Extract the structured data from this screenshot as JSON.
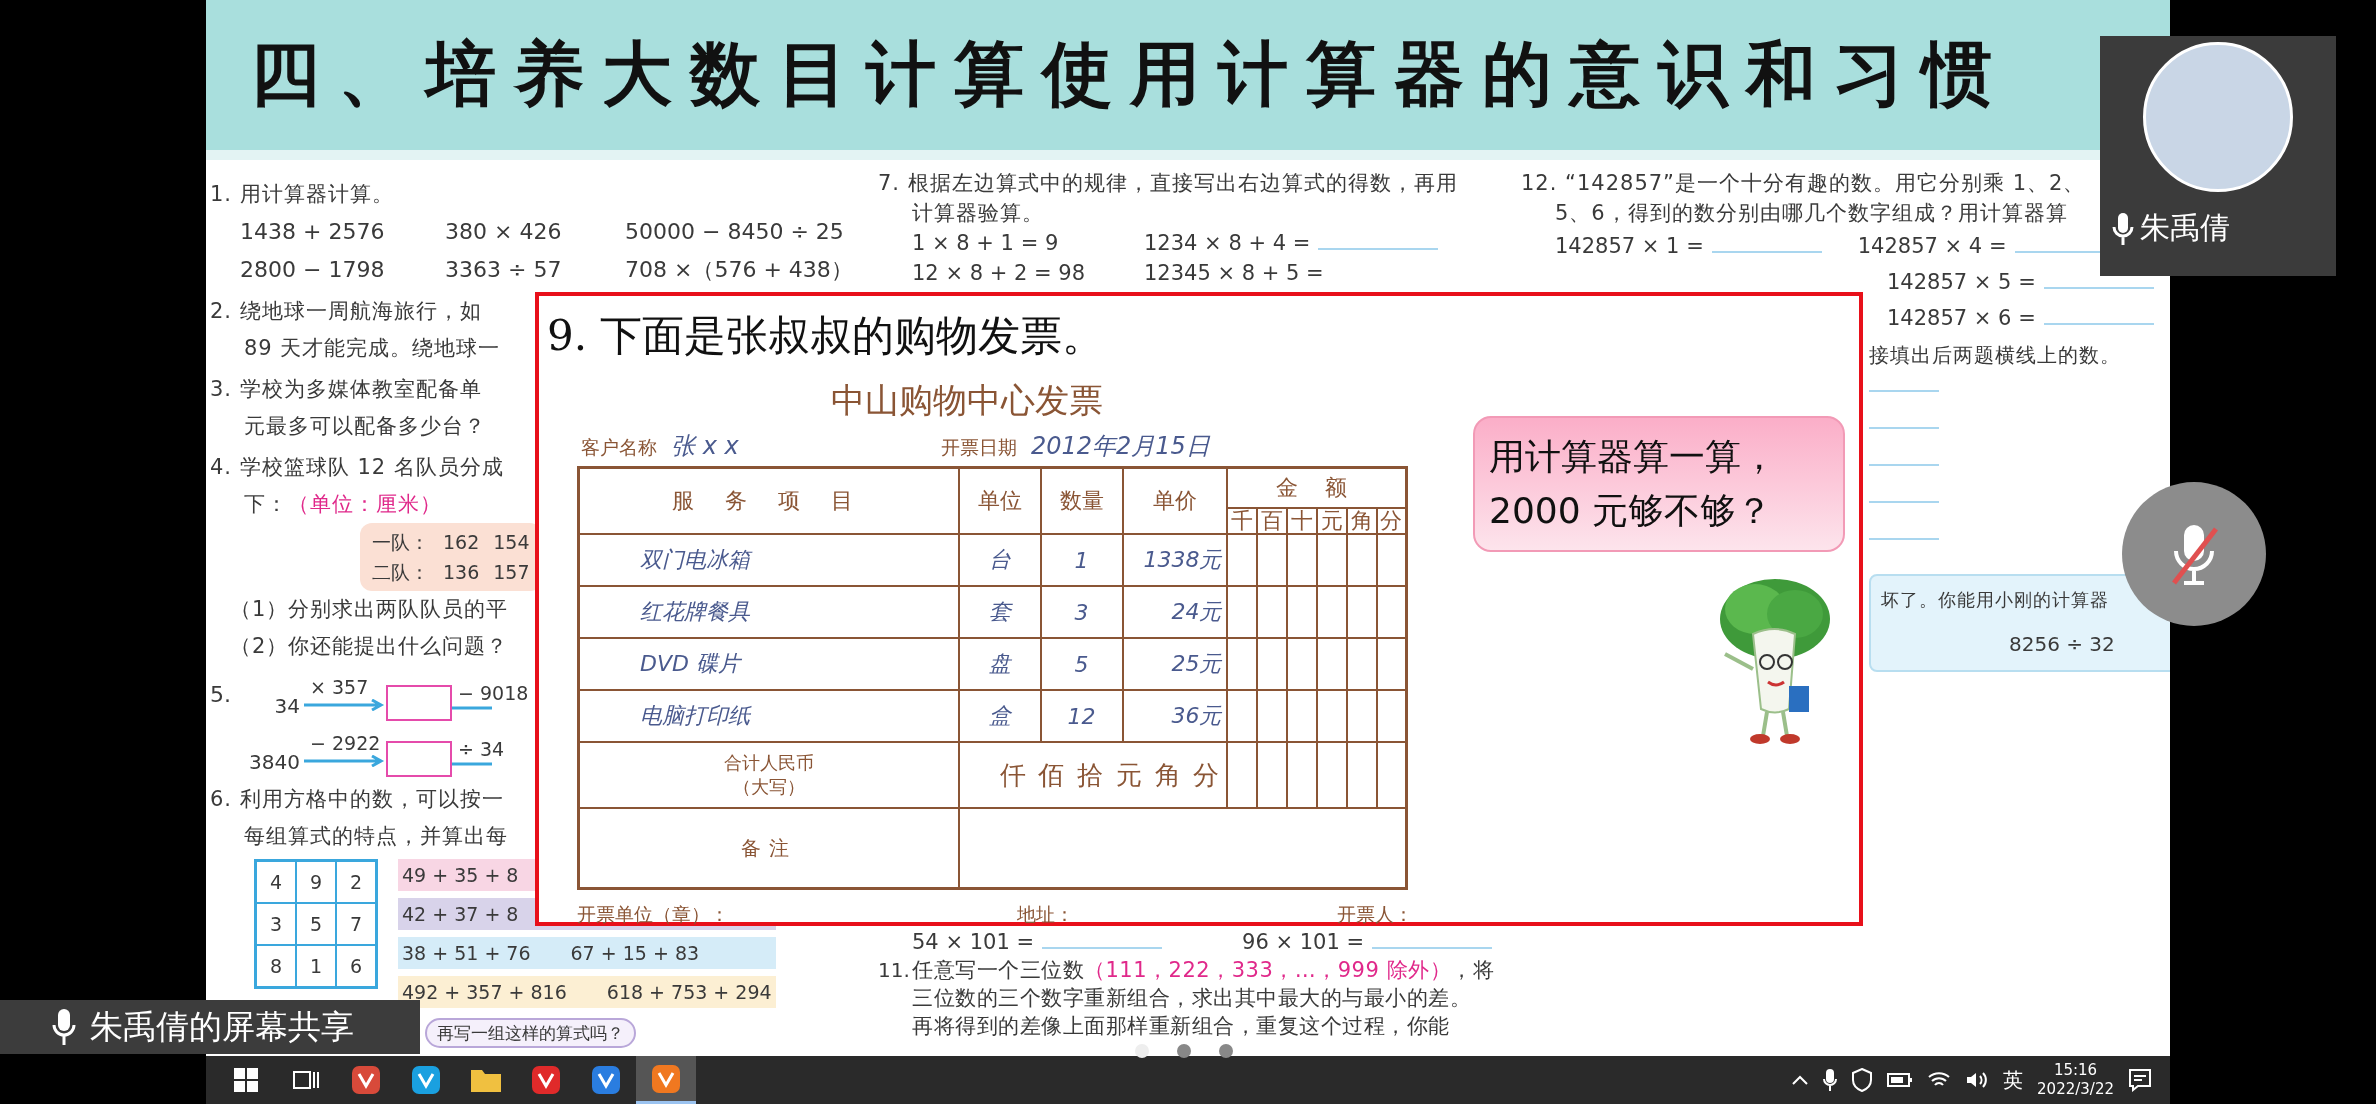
{
  "slide": {
    "title": "四、培养大数目计算使用计算器的意识和习惯"
  },
  "left_column": {
    "q1": {
      "text": "1. 用计算器计算。",
      "rows": [
        [
          "1438 + 2576",
          "380 × 426",
          "50000 − 8450 ÷ 25"
        ],
        [
          "2800 − 1798",
          "3363 ÷ 57",
          "708 ×（576 + 438）"
        ]
      ]
    },
    "q2": [
      "2. 绕地球一周航海旅行，如",
      "89 天才能完成。绕地球一"
    ],
    "q3": [
      "3. 学校为多媒体教室配备单",
      "元最多可以配备多少台？"
    ],
    "q4": {
      "text": "4. 学校篮球队 12 名队员分成",
      "lead": "下：",
      "unit": "（单位：厘米）",
      "teams": [
        {
          "label": "一队：",
          "values": [
            "162",
            "154"
          ]
        },
        {
          "label": "二队：",
          "values": [
            "136",
            "157"
          ]
        }
      ],
      "subquestions": [
        "（1）分别求出两队队员的平",
        "（2）你还能提出什么问题？"
      ]
    },
    "q5": {
      "number": "5.",
      "rows": [
        {
          "start": "34",
          "op1": "× 357",
          "op2": "− 9018"
        },
        {
          "start": "3840",
          "op1": "− 2922",
          "op2": "÷ 34"
        }
      ]
    },
    "q6": {
      "lines": [
        "6. 利用方格中的数，可以按一",
        "每组算式的特点，并算出每"
      ],
      "grid": [
        [
          "4",
          "9",
          "2"
        ],
        [
          "3",
          "5",
          "7"
        ],
        [
          "8",
          "1",
          "6"
        ]
      ],
      "groups": [
        {
          "color": "#f8d6e4",
          "items": [
            "49 + 35 + 8"
          ]
        },
        {
          "color": "#d8d3ea",
          "items": [
            "42 + 37 + 8"
          ]
        },
        {
          "color": "#d5ecf8",
          "items": [
            "38 + 51 + 76",
            "67 + 15 + 83"
          ]
        },
        {
          "color": "#fcefd3",
          "items": [
            "492 + 357 + 816",
            "618 + 753 + 294"
          ]
        }
      ],
      "bubble": "再写一组这样的算式吗？"
    }
  },
  "middle_column": {
    "q7": {
      "lines": [
        "7. 根据左边算式中的规律，直接写出右边算式的得数，再用",
        "计算器验算。"
      ],
      "rows": [
        {
          "left": "1 × 8 + 1 = 9",
          "right": "1234 × 8 + 4 =",
          "answer_line": true
        },
        {
          "left": "12 × 8 + 2 = 98",
          "right": "12345 × 8 + 5 =",
          "answer_line": false
        }
      ]
    },
    "q10_rows": [
      "54 × 101 =",
      "96 × 101 ="
    ],
    "q11": {
      "number": "11.",
      "before": "任意写一个三位数",
      "highlight": "（111，222，333，…，999 除外）",
      "after": "，将",
      "lines": [
        "三位数的三个数字重新组合，求出其中最大的与最小的差。",
        "再将得到的差像上面那样重新组合，重复这个过程，你能"
      ]
    }
  },
  "right_column": {
    "q12": {
      "lines": [
        "12. “142857”是一个十分有趣的数。用它分别乘 1、2、",
        "5、6，得到的数分别由哪几个数字组成？用计算器算"
      ],
      "first_row": [
        "142857 × 1 =",
        "142857 × 4 ="
      ],
      "more_rows": [
        "142857 × 5 =",
        "142857 × 6 ="
      ],
      "note": "接填出后两题横线上的数。"
    },
    "q13": {
      "text": "坏了。你能用小刚的计算器",
      "expression": "8256 ÷ 32"
    }
  },
  "popup": {
    "heading": "9. 下面是张叔叔的购物发票。",
    "invoice": {
      "title": "中山购物中心发票",
      "customer_label": "客户名称",
      "customer": "张 x x",
      "date_label": "开票日期",
      "date": "2012年2月15日",
      "headers": {
        "item": "服 务 项 目",
        "unit": "单位",
        "qty": "数量",
        "price": "单价",
        "amount": "金 额",
        "digits": [
          "千",
          "百",
          "十",
          "元",
          "角",
          "分"
        ]
      },
      "rows": [
        {
          "item": "双门电冰箱",
          "unit": "台",
          "qty": "1",
          "price": "1338元"
        },
        {
          "item": "红花牌餐具",
          "unit": "套",
          "qty": "3",
          "price": "24元"
        },
        {
          "item": "DVD 碟片",
          "unit": "盘",
          "qty": "5",
          "price": "25元"
        },
        {
          "item": "电脑打印纸",
          "unit": "盒",
          "qty": "12",
          "price": "36元"
        }
      ],
      "total_label": [
        "合计人民币",
        "（大写）"
      ],
      "total_units": [
        "仟",
        "佰",
        "拾",
        "元",
        "角",
        "分"
      ],
      "remark_label": "备注",
      "footer": [
        "开票单位（章）：",
        "地址：",
        "开票人："
      ]
    },
    "bubble": [
      "用计算器算一算，",
      "2000 元够不够？"
    ]
  },
  "participant": {
    "name": "朱禹倩"
  },
  "mic_button": {
    "muted": true
  },
  "share_label": "朱禹倩的屏幕共享",
  "page_dots": [
    {
      "selected": true
    },
    {
      "selected": false
    },
    {
      "selected": false
    }
  ],
  "taskbar": {
    "items": [
      {
        "kind": "start",
        "selected": false
      },
      {
        "kind": "task-view",
        "selected": false
      },
      {
        "kind": "app",
        "color": "#d84a3a",
        "selected": false
      },
      {
        "kind": "app",
        "color": "#1aa0e0",
        "selected": false
      },
      {
        "kind": "folder",
        "color": "#f0c040",
        "selected": false
      },
      {
        "kind": "app",
        "color": "#e02a2a",
        "selected": false
      },
      {
        "kind": "app",
        "color": "#2a7de0",
        "selected": false
      },
      {
        "kind": "app",
        "color": "#f07820",
        "selected": true
      }
    ],
    "ime": "英",
    "time": "15:16",
    "date": "2022/3/22"
  }
}
